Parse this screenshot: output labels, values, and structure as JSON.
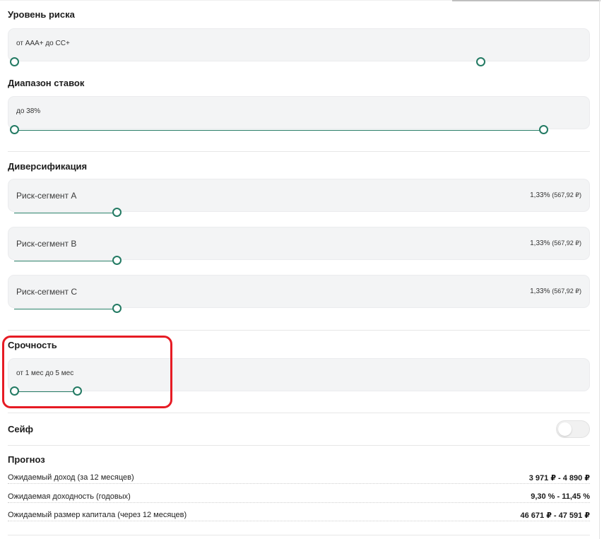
{
  "risk_level": {
    "title": "Уровень риска",
    "value_text": "от AAA+ до CC+"
  },
  "rate_range": {
    "title": "Диапазон ставок",
    "value_text": "до 38%"
  },
  "diversification": {
    "title": "Диверсификация",
    "segments": [
      {
        "label": "Риск-сегмент A",
        "percent": "1,33%",
        "amount": "(567,92 ₽)"
      },
      {
        "label": "Риск-сегмент B",
        "percent": "1,33%",
        "amount": "(567,92 ₽)"
      },
      {
        "label": "Риск-сегмент C",
        "percent": "1,33%",
        "amount": "(567,92 ₽)"
      }
    ]
  },
  "term": {
    "title": "Срочность",
    "value_text": "от 1 мес до 5 мес"
  },
  "safe": {
    "title": "Сейф",
    "enabled": false
  },
  "forecast": {
    "title": "Прогноз",
    "rows": [
      {
        "label": "Ожидаемый доход (за 12 месяцев)",
        "value": "3 971 ₽ - 4 890 ₽"
      },
      {
        "label": "Ожидаемая доходность (годовых)",
        "value": "9,30 % - 11,45 %"
      },
      {
        "label": "Ожидаемый размер капитала (через 12 месяцев)",
        "value": "46 671 ₽ - 47 591 ₽"
      }
    ]
  },
  "colors": {
    "accent": "#237a63",
    "highlight": "#e61b24",
    "card_bg": "#f3f4f5"
  }
}
